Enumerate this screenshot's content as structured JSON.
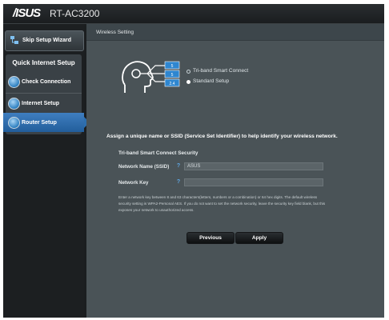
{
  "topbar": {
    "brand": "/ISUS",
    "model": "RT-AC3200"
  },
  "sidebar": {
    "skip_label": "Skip Setup Wizard",
    "section_title": "Quick Internet Setup",
    "items": [
      {
        "label": "Check Connection"
      },
      {
        "label": "Internet Setup"
      },
      {
        "label": "Router Setup"
      }
    ]
  },
  "main": {
    "header_title": "Wireless Setting",
    "illustration_bands": [
      "5",
      "5",
      "2.4"
    ],
    "options": [
      {
        "label": "Tri-band Smart Connect",
        "selected": false
      },
      {
        "label": "Standard Setup",
        "selected": true
      }
    ],
    "assign_text": "Assign a unique name or SSID (Service Set Identifier) to help identify your wireless network.",
    "section_title": "Tri-band Smart Connect Security",
    "network_name_label": "Network Name (SSID)",
    "network_name_value": "ASUS",
    "network_key_label": "Network Key",
    "network_key_value": "",
    "help_glyph": "?",
    "description": "Enter a network key between 8 and 63 characters(letters, numbers or a combination) or 64 hex digits. The default wireless security setting is WPA2-Personal AES. If you do not want to set the network security, leave the security key field blank, but this exposes your network to unauthorized access.",
    "previous_label": "Previous",
    "apply_label": "Apply"
  },
  "colors": {
    "active_blue": "#2d6eae",
    "panel_gray": "#4a5357",
    "frame_dark": "#1b1e20"
  }
}
